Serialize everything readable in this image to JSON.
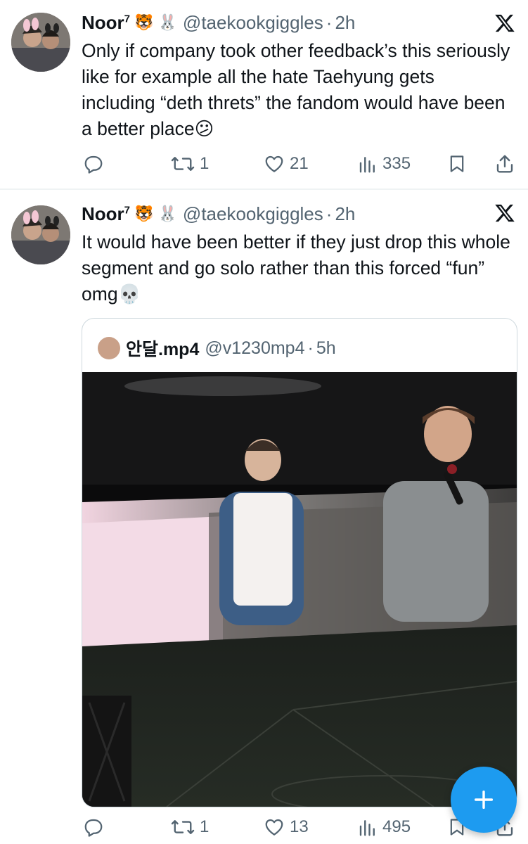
{
  "tweets": [
    {
      "author_name": "Noor",
      "author_sup": "7",
      "author_emojis": "🐯 🐰",
      "handle": "@taekookgiggles",
      "separator": "·",
      "time": "2h",
      "text": "Only if company took other feedback’s this seriously like for example all the hate Taehyung gets including “deth threts” the fandom would have been a better place",
      "text_emoji": "😕",
      "replies": "",
      "retweets": "1",
      "likes": "21",
      "views": "335"
    },
    {
      "author_name": "Noor",
      "author_sup": "7",
      "author_emojis": "🐯 🐰",
      "handle": "@taekookgiggles",
      "separator": "·",
      "time": "2h",
      "text": "It would have been better if they just drop this whole segment and go solo rather than this forced “fun” omg",
      "text_emoji": "💀",
      "replies": "",
      "retweets": "1",
      "likes": "13",
      "views": "495",
      "quote": {
        "author_name": "안달.mp4",
        "handle": "@v1230mp4",
        "separator": "·",
        "time": "5h"
      }
    }
  ],
  "icons": {
    "reply": "reply-icon",
    "retweet": "retweet-icon",
    "like": "heart-icon",
    "views": "views-icon",
    "bookmark": "bookmark-icon",
    "share": "share-icon",
    "platform": "x-logo-icon",
    "compose": "plus-icon"
  },
  "colors": {
    "text": "#0f1419",
    "secondary": "#536471",
    "accent": "#1d9bf0",
    "border": "#cfd9de"
  }
}
